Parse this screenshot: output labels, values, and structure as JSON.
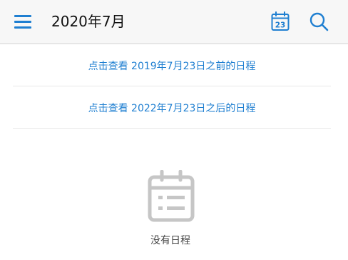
{
  "header": {
    "title": "2020年7月",
    "today_day": "23",
    "accent": "#1f7fd1"
  },
  "links": {
    "before": "点击查看 2019年7月23日之前的日程",
    "after": "点击查看 2022年7月23日之后的日程"
  },
  "empty": {
    "text": "没有日程"
  },
  "icons": [
    "menu-icon",
    "calendar-today-icon",
    "search-icon",
    "empty-schedule-icon"
  ]
}
